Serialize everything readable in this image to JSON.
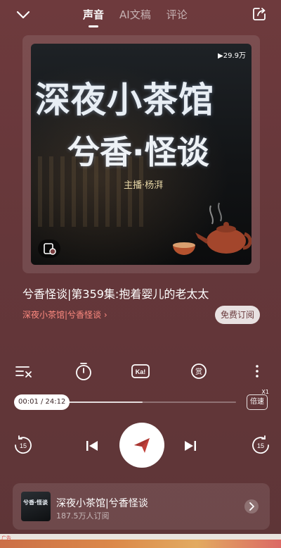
{
  "header": {
    "tabs": [
      {
        "label": "声音",
        "active": true
      },
      {
        "label": "AI文稿",
        "active": false
      },
      {
        "label": "评论",
        "active": false
      }
    ]
  },
  "cover": {
    "play_count": "▶29.9万",
    "title_line1": "深夜小茶馆",
    "title_line2": "兮香·怪谈",
    "host": "主播·杨湃"
  },
  "episode": {
    "title": "兮香怪谈|第359集:抱着婴儿的老太太",
    "album_link": "深夜小茶馆|兮香怪谈 ›",
    "subscribe_label": "免费订阅"
  },
  "player": {
    "time_label": "00:01 / 24:12",
    "progress_fraction": 0.58,
    "speed_label": "倍速",
    "speed_multiplier": "X1",
    "skip_seconds": "15"
  },
  "mini_player": {
    "album_name": "深夜小茶馆|兮香怪谈",
    "subscribers": "187.5万人订阅",
    "thumb_text": "兮香·怪谈"
  },
  "ad": {
    "tag": "广告"
  },
  "colors": {
    "background": "#6e3a3d",
    "accent_link": "#ff8a80",
    "play_button": "#ffffff"
  }
}
